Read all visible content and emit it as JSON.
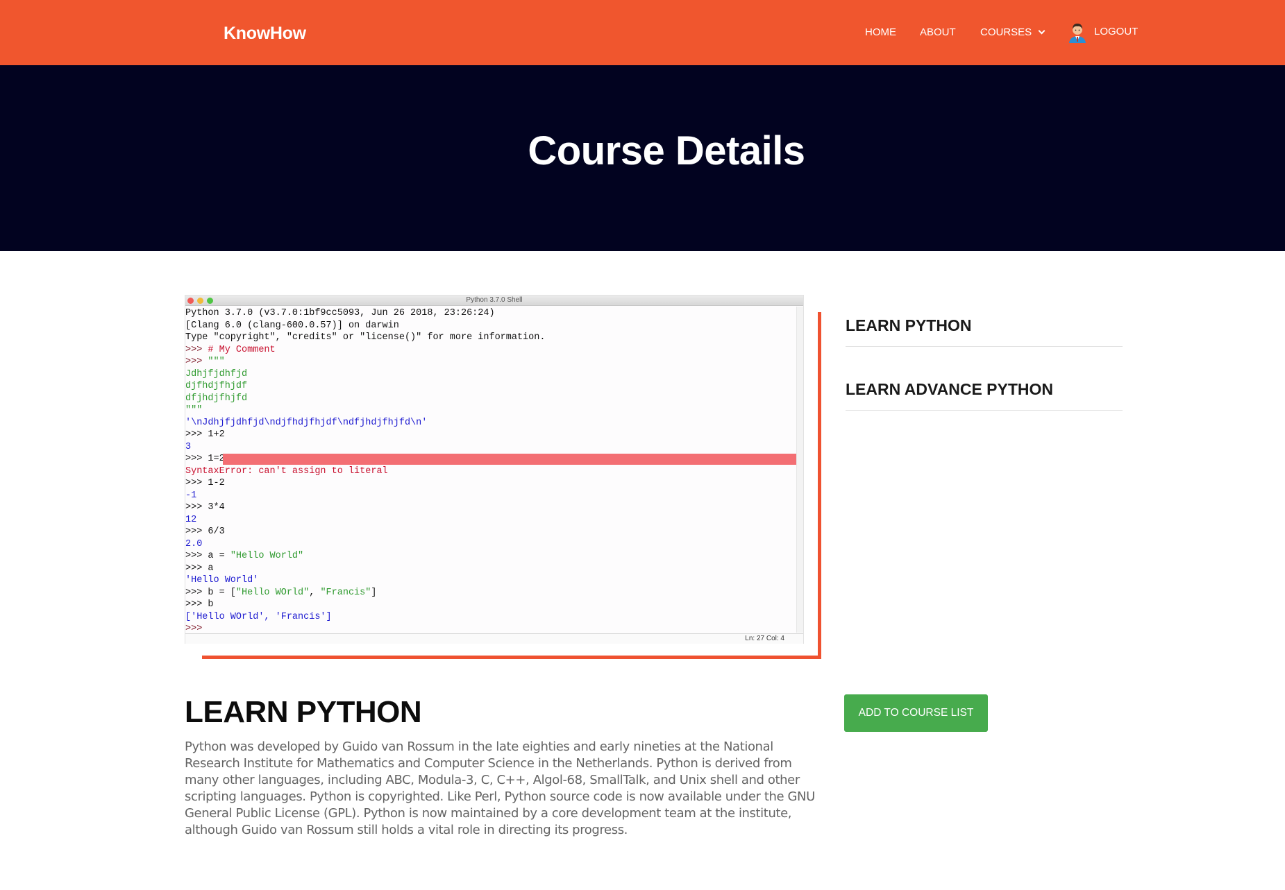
{
  "navbar": {
    "brand": "KnowHow",
    "links": {
      "home": "HOME",
      "about": "ABOUT",
      "courses": "COURSES",
      "logout": "LOGOUT"
    },
    "color": "#f0562e"
  },
  "hero": {
    "title": "Course Details",
    "color": "#020320"
  },
  "screenshot": {
    "window_title": "Python 3.7.0 Shell",
    "lines": [
      "Python 3.7.0 (v3.7.0:1bf9cc5093, Jun 26 2018, 23:26:24)",
      "[Clang 6.0 (clang-600.0.57)] on darwin",
      "Type \"copyright\", \"credits\" or \"license()\" for more information.",
      ">>> ",
      "# My Comment",
      ">>> ",
      "\"\"\"",
      "Jdhjfjdhfjd",
      "djfhdjfhjdf",
      "dfjhdjfhjfd",
      "\"\"\"",
      "'\\nJdhjfjdhfjd\\ndjfhdjfhjdf\\ndfjhdjfhjfd\\n'",
      ">>> 1+2",
      "3",
      ">>> 1=2",
      "SyntaxError: can't assign to literal",
      ">>> 1-2",
      "-1",
      ">>> 3*4",
      "12",
      ">>> 6/3",
      "2.0",
      ">>> a = ",
      "\"Hello World\"",
      ">>> a",
      "'Hello World'",
      ">>> b = [",
      "\"Hello WOrld\"",
      ", ",
      "\"Francis\"",
      "]",
      ">>> b",
      "['Hello WOrld', 'Francis']",
      ">>>"
    ],
    "status": "Ln: 27   Col: 4"
  },
  "sidebar": {
    "items": [
      "LEARN PYTHON",
      "LEARN ADVANCE PYTHON"
    ]
  },
  "course": {
    "title": "LEARN PYTHON",
    "description": "Python was developed by Guido van Rossum in the late eighties and early nineties at the National Research Institute for Mathematics and Computer Science in the Netherlands. Python is derived from many other languages, including ABC, Modula-3, C, C++, Algol-68, SmallTalk, and Unix shell and other scripting languages. Python is copyrighted. Like Perl, Python source code is now available under the GNU General Public License (GPL). Python is now maintained by a core development team at the institute, although Guido van Rossum still holds a vital role in directing its progress.",
    "add_button": "ADD TO COURSE LIST",
    "button_color": "#47ab4d"
  },
  "icons": {
    "avatar": "user-avatar-icon",
    "courses_dropdown": "chevron-down-icon"
  }
}
